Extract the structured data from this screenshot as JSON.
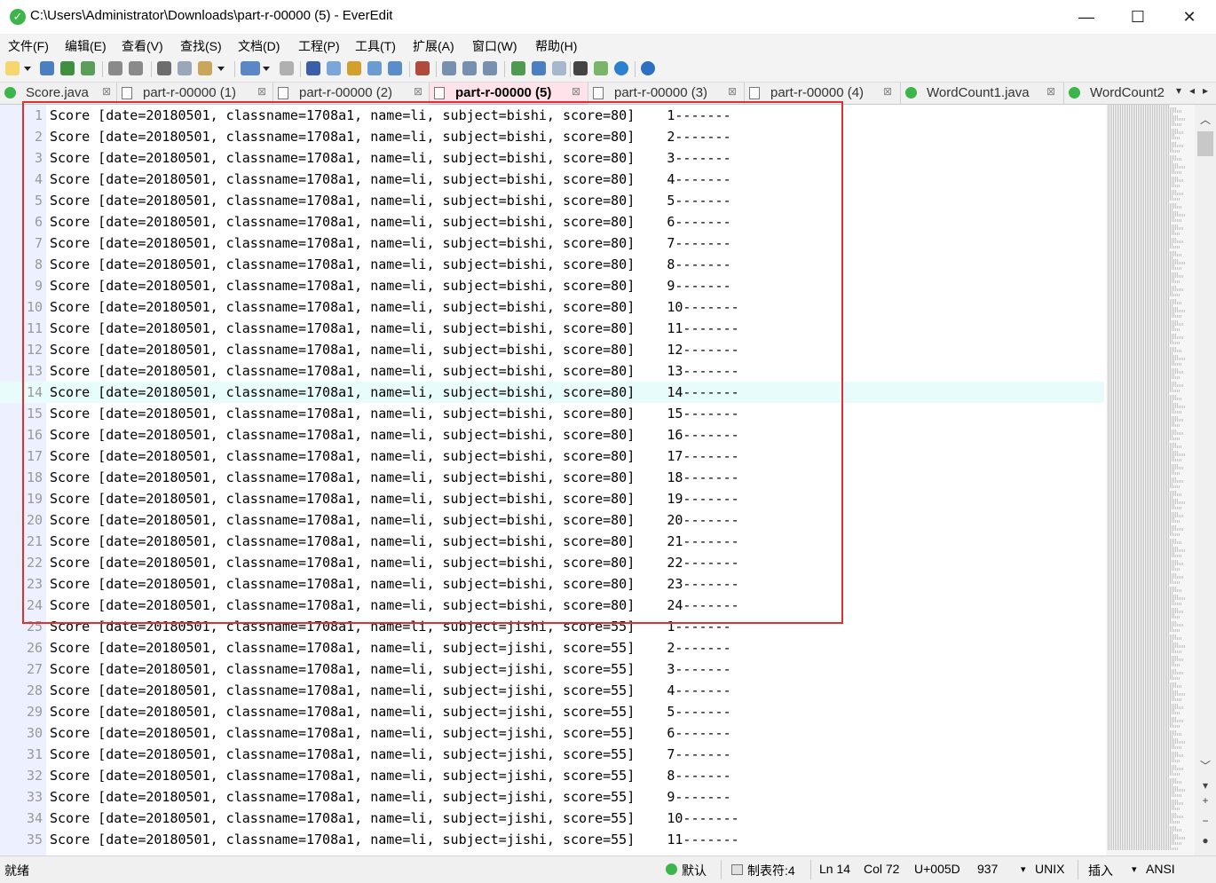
{
  "window": {
    "title": "C:\\Users\\Administrator\\Downloads\\part-r-00000 (5) - EverEdit",
    "minimize": "—",
    "maximize": "☐",
    "close": "✕"
  },
  "menu": [
    "文件(F)",
    "编辑(E)",
    "查看(V)",
    "查找(S)",
    "文档(D)",
    "工程(P)",
    "工具(T)",
    "扩展(A)",
    "窗口(W)",
    "帮助(H)"
  ],
  "tabs": [
    {
      "label": "Score.java",
      "icon": "java-file-icon"
    },
    {
      "label": "part-r-00000 (1)",
      "icon": "document-icon"
    },
    {
      "label": "part-r-00000 (2)",
      "icon": "document-icon"
    },
    {
      "label": "part-r-00000 (5)",
      "icon": "document-icon"
    },
    {
      "label": "part-r-00000 (3)",
      "icon": "document-icon"
    },
    {
      "label": "part-r-00000 (4)",
      "icon": "document-icon"
    },
    {
      "label": "WordCount1.java",
      "icon": "java-file-icon"
    },
    {
      "label": "WordCount2",
      "icon": "java-file-icon"
    }
  ],
  "active_tab": "part-r-00000 (5)",
  "tab_close_glyph": "⊠",
  "editor": {
    "current_line": 14,
    "lines": [
      {
        "n": "1",
        "text": "Score [date=20180501, classname=1708a1, name=li, subject=bishi, score=80]    1-------"
      },
      {
        "n": "2",
        "text": "Score [date=20180501, classname=1708a1, name=li, subject=bishi, score=80]    2-------"
      },
      {
        "n": "3",
        "text": "Score [date=20180501, classname=1708a1, name=li, subject=bishi, score=80]    3-------"
      },
      {
        "n": "4",
        "text": "Score [date=20180501, classname=1708a1, name=li, subject=bishi, score=80]    4-------"
      },
      {
        "n": "5",
        "text": "Score [date=20180501, classname=1708a1, name=li, subject=bishi, score=80]    5-------"
      },
      {
        "n": "6",
        "text": "Score [date=20180501, classname=1708a1, name=li, subject=bishi, score=80]    6-------"
      },
      {
        "n": "7",
        "text": "Score [date=20180501, classname=1708a1, name=li, subject=bishi, score=80]    7-------"
      },
      {
        "n": "8",
        "text": "Score [date=20180501, classname=1708a1, name=li, subject=bishi, score=80]    8-------"
      },
      {
        "n": "9",
        "text": "Score [date=20180501, classname=1708a1, name=li, subject=bishi, score=80]    9-------"
      },
      {
        "n": "10",
        "text": "Score [date=20180501, classname=1708a1, name=li, subject=bishi, score=80]    10-------"
      },
      {
        "n": "11",
        "text": "Score [date=20180501, classname=1708a1, name=li, subject=bishi, score=80]    11-------"
      },
      {
        "n": "12",
        "text": "Score [date=20180501, classname=1708a1, name=li, subject=bishi, score=80]    12-------"
      },
      {
        "n": "13",
        "text": "Score [date=20180501, classname=1708a1, name=li, subject=bishi, score=80]    13-------"
      },
      {
        "n": "14",
        "text": "Score [date=20180501, classname=1708a1, name=li, subject=bishi, score=80]    14-------"
      },
      {
        "n": "15",
        "text": "Score [date=20180501, classname=1708a1, name=li, subject=bishi, score=80]    15-------"
      },
      {
        "n": "16",
        "text": "Score [date=20180501, classname=1708a1, name=li, subject=bishi, score=80]    16-------"
      },
      {
        "n": "17",
        "text": "Score [date=20180501, classname=1708a1, name=li, subject=bishi, score=80]    17-------"
      },
      {
        "n": "18",
        "text": "Score [date=20180501, classname=1708a1, name=li, subject=bishi, score=80]    18-------"
      },
      {
        "n": "19",
        "text": "Score [date=20180501, classname=1708a1, name=li, subject=bishi, score=80]    19-------"
      },
      {
        "n": "20",
        "text": "Score [date=20180501, classname=1708a1, name=li, subject=bishi, score=80]    20-------"
      },
      {
        "n": "21",
        "text": "Score [date=20180501, classname=1708a1, name=li, subject=bishi, score=80]    21-------"
      },
      {
        "n": "22",
        "text": "Score [date=20180501, classname=1708a1, name=li, subject=bishi, score=80]    22-------"
      },
      {
        "n": "23",
        "text": "Score [date=20180501, classname=1708a1, name=li, subject=bishi, score=80]    23-------"
      },
      {
        "n": "24",
        "text": "Score [date=20180501, classname=1708a1, name=li, subject=bishi, score=80]    24-------"
      },
      {
        "n": "25",
        "text": "Score [date=20180501, classname=1708a1, name=li, subject=jishi, score=55]    1-------"
      },
      {
        "n": "26",
        "text": "Score [date=20180501, classname=1708a1, name=li, subject=jishi, score=55]    2-------"
      },
      {
        "n": "27",
        "text": "Score [date=20180501, classname=1708a1, name=li, subject=jishi, score=55]    3-------"
      },
      {
        "n": "28",
        "text": "Score [date=20180501, classname=1708a1, name=li, subject=jishi, score=55]    4-------"
      },
      {
        "n": "29",
        "text": "Score [date=20180501, classname=1708a1, name=li, subject=jishi, score=55]    5-------"
      },
      {
        "n": "30",
        "text": "Score [date=20180501, classname=1708a1, name=li, subject=jishi, score=55]    6-------"
      },
      {
        "n": "31",
        "text": "Score [date=20180501, classname=1708a1, name=li, subject=jishi, score=55]    7-------"
      },
      {
        "n": "32",
        "text": "Score [date=20180501, classname=1708a1, name=li, subject=jishi, score=55]    8-------"
      },
      {
        "n": "33",
        "text": "Score [date=20180501, classname=1708a1, name=li, subject=jishi, score=55]    9-------"
      },
      {
        "n": "34",
        "text": "Score [date=20180501, classname=1708a1, name=li, subject=jishi, score=55]    10-------"
      },
      {
        "n": "35",
        "text": "Score [date=20180501, classname=1708a1, name=li, subject=jishi, score=55]    11-------"
      }
    ]
  },
  "annotation": {
    "color": "#e03030",
    "covers_lines": "1-24"
  },
  "status": {
    "ready": "就绪",
    "default_label": "默认",
    "tab_label": "制表符:4",
    "line": "Ln 14",
    "col": "Col 72",
    "char": "U+005D",
    "offset": "937",
    "line_ending": "UNIX",
    "insert_mode": "插入",
    "encoding": "ANSI"
  },
  "colors": {
    "gutter": "#ecf0ff",
    "current_line": "#e9fcfc",
    "active_tab": "#ffe2ea",
    "logo": "#3cb54a"
  }
}
